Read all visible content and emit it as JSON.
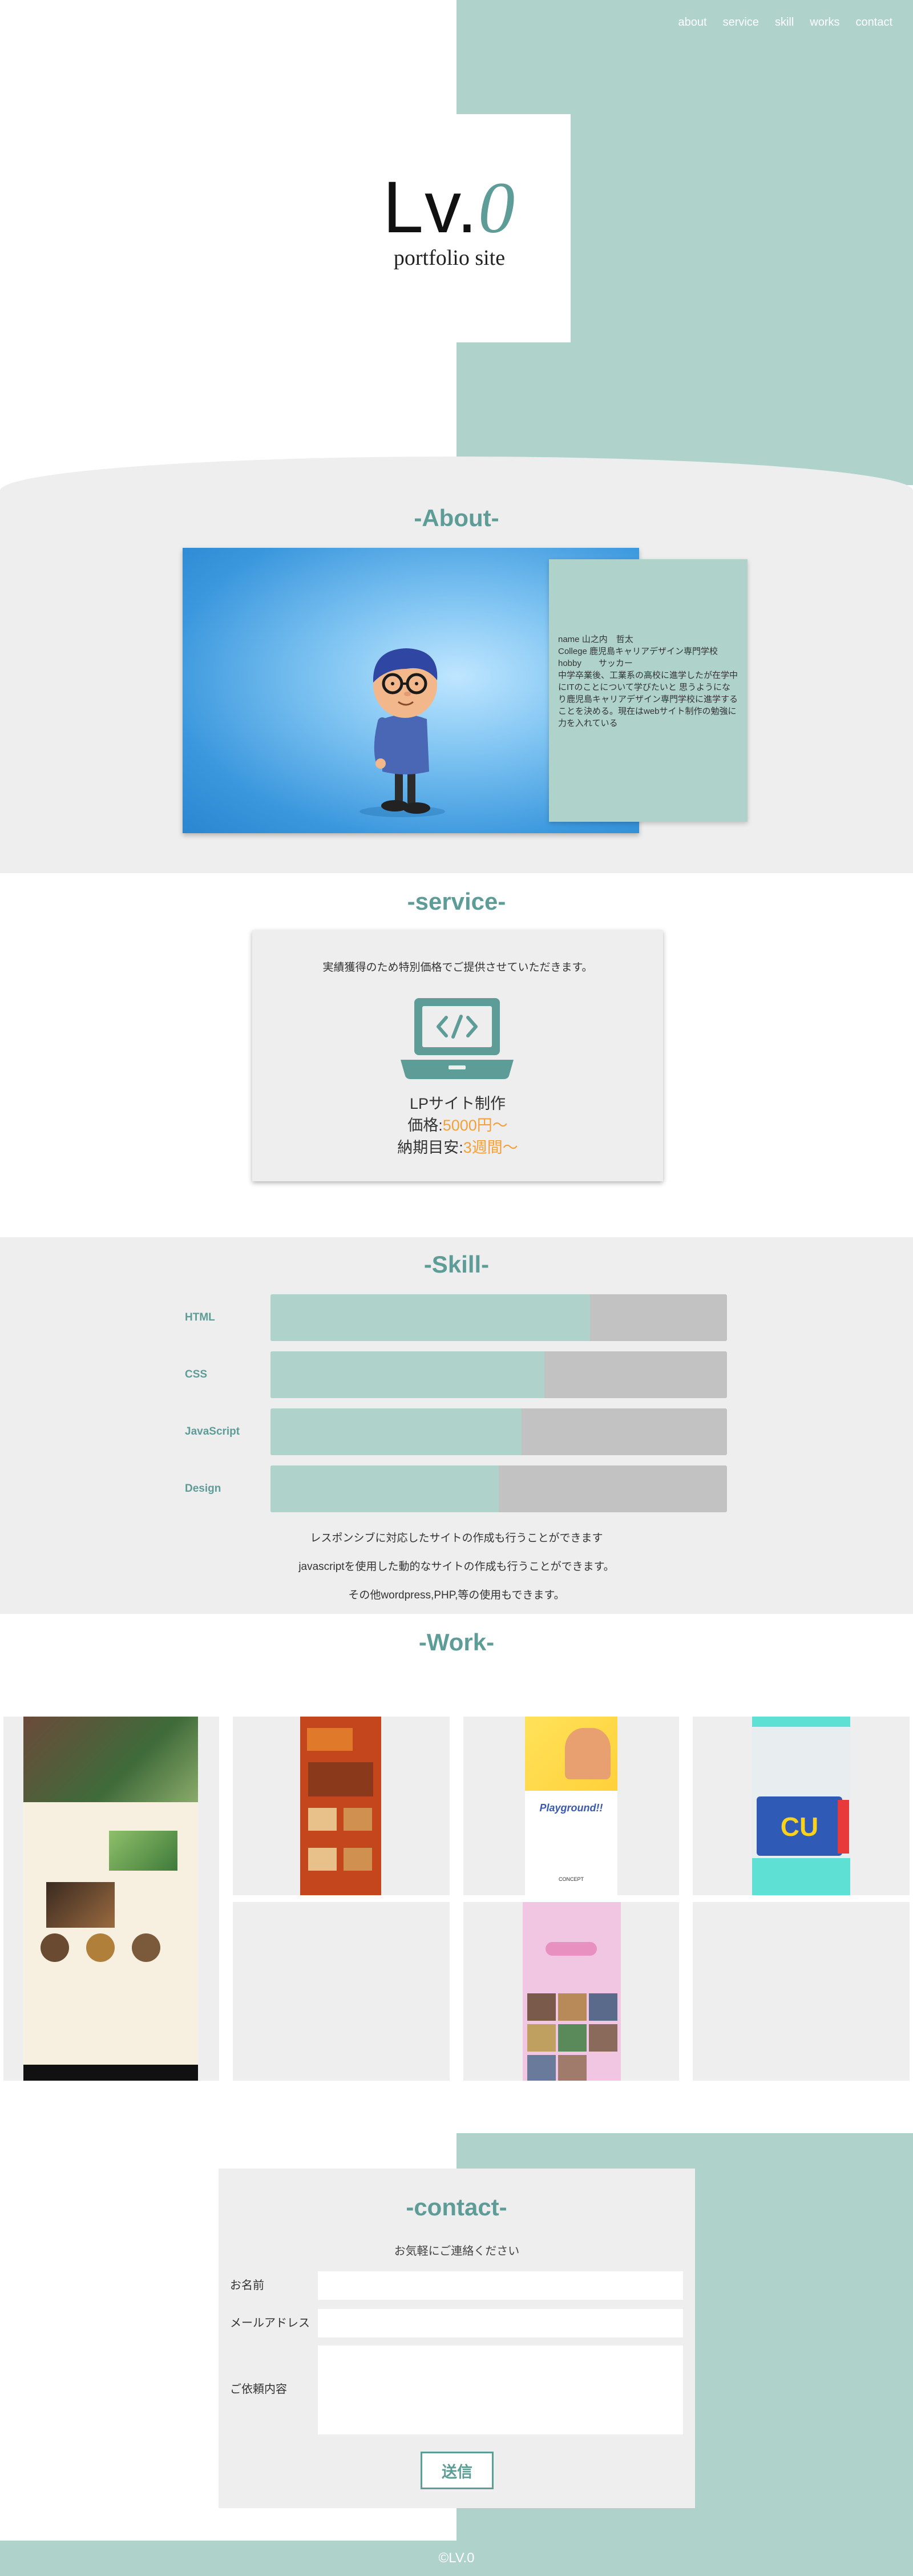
{
  "nav": {
    "items": [
      "about",
      "service",
      "skill",
      "works",
      "contact"
    ]
  },
  "hero": {
    "logo_main": "Lv.",
    "logo_accent": "0",
    "subtitle": "portfolio site"
  },
  "about": {
    "title": "-About-",
    "name_line": "name 山之内　哲太",
    "college_line": "College 鹿児島キャリアデザイン専門学校",
    "hobby_line": "hobby　　サッカー",
    "bio": "中学卒業後、工業系の高校に進学したが在学中にITのことについて学びたいと 思うようになり鹿児島キャリアデザイン専門学校に進学することを決める。現在はwebサイト制作の勉強に力を入れている"
  },
  "service": {
    "title": "-service-",
    "intro": "実績獲得のため特別価格でご提供させていただきます。",
    "icon": "laptop-code-icon",
    "item": "LPサイト制作",
    "price_label": "価格:",
    "price_value": "5000円〜",
    "delivery_label": "納期目安:",
    "delivery_value": "3週間〜"
  },
  "skill": {
    "title": "-Skill-",
    "items": [
      {
        "label": "HTML",
        "level": 0.7
      },
      {
        "label": "CSS",
        "level": 0.6
      },
      {
        "label": "JavaScript",
        "level": 0.55
      },
      {
        "label": "Design",
        "level": 0.5
      }
    ],
    "notes": [
      "レスポンシブに対応したサイトの作成も行うことができます",
      "javascriptを使用した動的なサイトの作成も行うことができます。",
      "その他wordpress,PHP,等の使用もできます。"
    ]
  },
  "work": {
    "title": "-Work-",
    "card_text": {
      "playground": "Playground!!",
      "concept": "CONCEPT",
      "cu": "CU"
    }
  },
  "contact": {
    "title": "-contact-",
    "subtitle": "お気軽にご連絡ください",
    "name_label": "お名前",
    "email_label": "メールアドレス",
    "message_label": "ご依頼内容",
    "submit": "送信"
  },
  "footer": {
    "copyright": "©LV.0"
  },
  "colors": {
    "accent": "#afd3cb",
    "title": "#5e9c97",
    "panel": "#eeeeee",
    "price": "#f2a03a"
  }
}
